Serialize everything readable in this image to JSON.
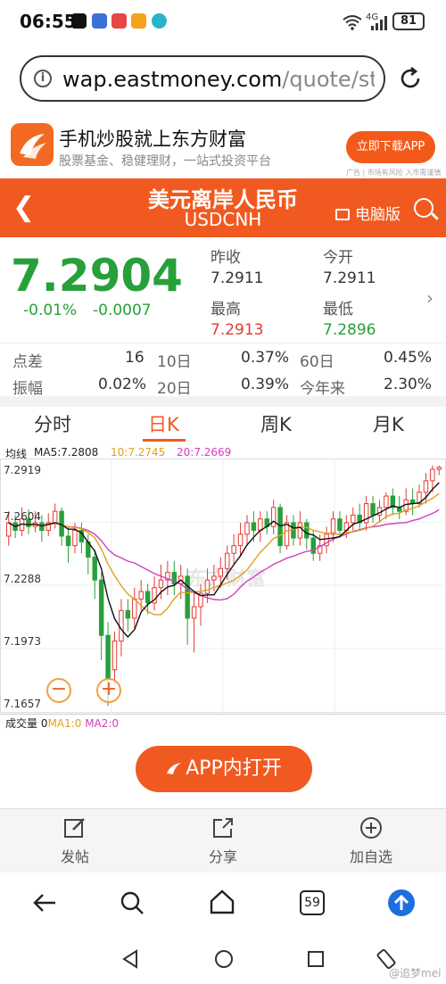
{
  "status_bar": {
    "time": "06:55",
    "network": "4G",
    "battery": "81"
  },
  "browser": {
    "url_domain": "wap.eastmoney.com",
    "url_path": "/quote/stoc"
  },
  "ad_banner": {
    "title": "手机炒股就上东方财富",
    "subtitle": "股票基金、稳健理财，一站式投资平台",
    "button": "立即下载APP",
    "footnote": "广告 | 市场有风险 入市需谨慎"
  },
  "header": {
    "title": "美元离岸人民币",
    "code": "USDCNH",
    "pc_label": "电脑版"
  },
  "quote": {
    "price": "7.2904",
    "change_pct": "-0.01%",
    "change": "-0.0007",
    "prev_close_label": "昨收",
    "prev_close": "7.2911",
    "open_label": "今开",
    "open": "7.2911",
    "high_label": "最高",
    "high": "7.2913",
    "low_label": "最低",
    "low": "7.2896"
  },
  "stats": {
    "spread_label": "点差",
    "spread": "16",
    "d10_label": "10日",
    "d10": "0.37%",
    "d60_label": "60日",
    "d60": "0.45%",
    "amp_label": "振幅",
    "amp": "0.02%",
    "d20_label": "20日",
    "d20": "0.39%",
    "ytd_label": "今年来",
    "ytd": "2.30%"
  },
  "tabs": [
    "分时",
    "日K",
    "周K",
    "月K"
  ],
  "ma_legend": {
    "label": "均线",
    "ma5": "MA5:7.2808",
    "ma10": "10:7.2745",
    "ma20": "20:7.2669"
  },
  "chart_watermark": "东方财富",
  "chart_data": {
    "type": "candlestick",
    "ylim": [
      7.1657,
      7.2919
    ],
    "yticks": [
      "7.2919",
      "7.2604",
      "7.2288",
      "7.1973",
      "7.1657"
    ],
    "up_color": "#e53935",
    "down_color": "#27a03a",
    "ma_colors": {
      "ma5": "#111111",
      "ma10": "#e0a020",
      "ma20": "#d040c0"
    },
    "candles": [
      [
        7.255,
        7.262,
        7.268,
        7.25
      ],
      [
        7.262,
        7.258,
        7.266,
        7.254
      ],
      [
        7.258,
        7.264,
        7.27,
        7.255
      ],
      [
        7.264,
        7.26,
        7.269,
        7.256
      ],
      [
        7.26,
        7.262,
        7.268,
        7.257
      ],
      [
        7.262,
        7.258,
        7.266,
        7.252
      ],
      [
        7.258,
        7.262,
        7.267,
        7.255
      ],
      [
        7.262,
        7.268,
        7.272,
        7.259
      ],
      [
        7.268,
        7.255,
        7.27,
        7.25
      ],
      [
        7.255,
        7.25,
        7.26,
        7.241
      ],
      [
        7.25,
        7.258,
        7.262,
        7.246
      ],
      [
        7.258,
        7.252,
        7.262,
        7.246
      ],
      [
        7.252,
        7.244,
        7.256,
        7.235
      ],
      [
        7.244,
        7.232,
        7.248,
        7.222
      ],
      [
        7.232,
        7.203,
        7.236,
        7.19
      ],
      [
        7.203,
        7.18,
        7.21,
        7.166
      ],
      [
        7.185,
        7.2,
        7.205,
        7.178
      ],
      [
        7.2,
        7.216,
        7.222,
        7.192
      ],
      [
        7.216,
        7.212,
        7.222,
        7.205
      ],
      [
        7.212,
        7.222,
        7.228,
        7.206
      ],
      [
        7.222,
        7.226,
        7.232,
        7.216
      ],
      [
        7.226,
        7.22,
        7.23,
        7.214
      ],
      [
        7.22,
        7.228,
        7.234,
        7.216
      ],
      [
        7.228,
        7.232,
        7.24,
        7.222
      ],
      [
        7.232,
        7.236,
        7.242,
        7.224
      ],
      [
        7.236,
        7.23,
        7.242,
        7.224
      ],
      [
        7.23,
        7.234,
        7.24,
        7.222
      ],
      [
        7.234,
        7.212,
        7.238,
        7.198
      ],
      [
        7.212,
        7.218,
        7.226,
        7.194
      ],
      [
        7.218,
        7.225,
        7.23,
        7.208
      ],
      [
        7.225,
        7.232,
        7.238,
        7.22
      ],
      [
        7.232,
        7.234,
        7.24,
        7.226
      ],
      [
        7.234,
        7.238,
        7.244,
        7.228
      ],
      [
        7.238,
        7.246,
        7.25,
        7.232
      ],
      [
        7.246,
        7.25,
        7.256,
        7.24
      ],
      [
        7.25,
        7.256,
        7.262,
        7.244
      ],
      [
        7.256,
        7.262,
        7.266,
        7.25
      ],
      [
        7.262,
        7.258,
        7.268,
        7.252
      ],
      [
        7.258,
        7.264,
        7.268,
        7.252
      ],
      [
        7.264,
        7.26,
        7.268,
        7.256
      ],
      [
        7.26,
        7.27,
        7.274,
        7.256
      ],
      [
        7.27,
        7.25,
        7.272,
        7.246
      ],
      [
        7.25,
        7.262,
        7.266,
        7.248
      ],
      [
        7.262,
        7.254,
        7.266,
        7.25
      ],
      [
        7.254,
        7.262,
        7.268,
        7.25
      ],
      [
        7.262,
        7.254,
        7.264,
        7.248
      ],
      [
        7.254,
        7.246,
        7.258,
        7.242
      ],
      [
        7.246,
        7.25,
        7.256,
        7.242
      ],
      [
        7.25,
        7.256,
        7.26,
        7.246
      ],
      [
        7.256,
        7.264,
        7.268,
        7.252
      ],
      [
        7.264,
        7.258,
        7.268,
        7.254
      ],
      [
        7.258,
        7.262,
        7.266,
        7.254
      ],
      [
        7.262,
        7.266,
        7.27,
        7.258
      ],
      [
        7.266,
        7.262,
        7.272,
        7.258
      ],
      [
        7.262,
        7.272,
        7.276,
        7.258
      ],
      [
        7.272,
        7.266,
        7.276,
        7.262
      ],
      [
        7.266,
        7.27,
        7.274,
        7.262
      ],
      [
        7.27,
        7.276,
        7.278,
        7.264
      ],
      [
        7.276,
        7.27,
        7.28,
        7.266
      ],
      [
        7.27,
        7.268,
        7.276,
        7.264
      ],
      [
        7.268,
        7.274,
        7.28,
        7.266
      ],
      [
        7.274,
        7.272,
        7.28,
        7.266
      ],
      [
        7.272,
        7.278,
        7.282,
        7.27
      ],
      [
        7.278,
        7.284,
        7.288,
        7.272
      ],
      [
        7.284,
        7.29,
        7.292,
        7.278
      ],
      [
        7.29,
        7.291,
        7.2919,
        7.287
      ]
    ]
  },
  "volume": {
    "label": "成交量",
    "value": "0",
    "ma1": "MA1:0",
    "ma2": "MA2:0"
  },
  "open_app_button": "APP内打开",
  "actions": [
    {
      "label": "发帖",
      "icon": "edit-icon"
    },
    {
      "label": "分享",
      "icon": "share-icon"
    },
    {
      "label": "加自选",
      "icon": "add-icon"
    }
  ],
  "browser_nav": {
    "tab_count": "59"
  },
  "watermark": "@追梦mei"
}
